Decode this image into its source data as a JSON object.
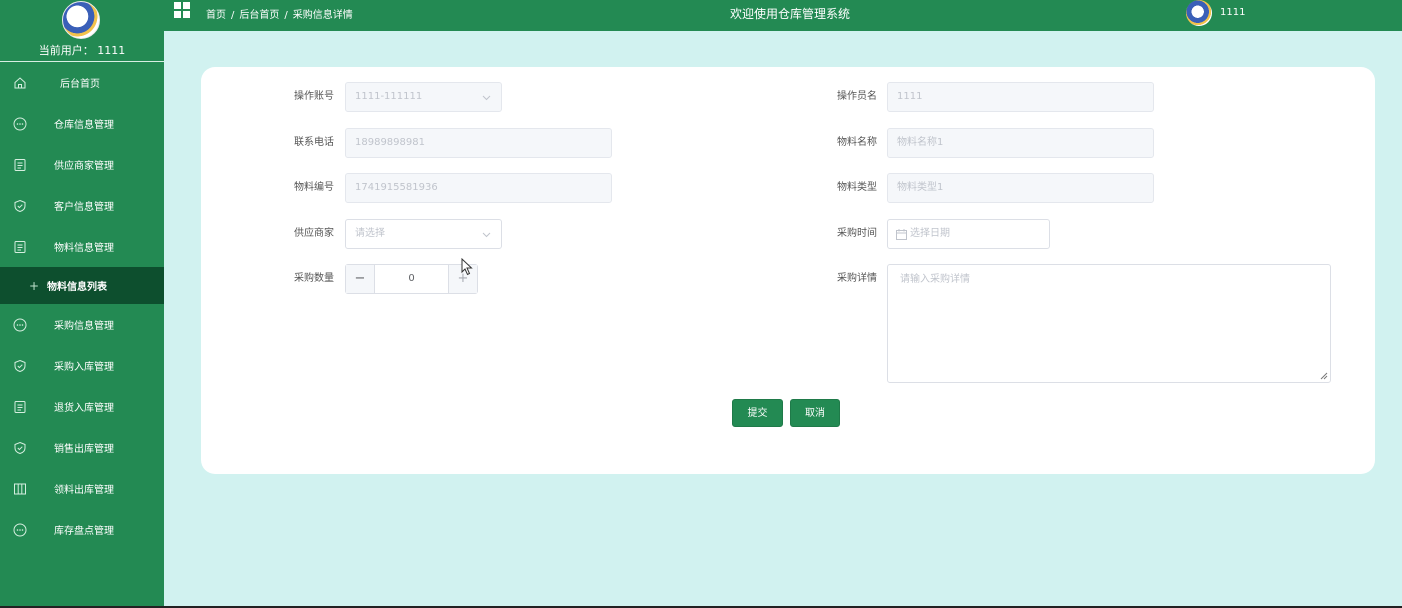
{
  "sidebar": {
    "current_user": "当前用户： 1111",
    "items": [
      {
        "label": "后台首页",
        "icon": "home-icon"
      },
      {
        "label": "仓库信息管理",
        "icon": "chat-icon"
      },
      {
        "label": "供应商家管理",
        "icon": "document-icon"
      },
      {
        "label": "客户信息管理",
        "icon": "shield-icon"
      },
      {
        "label": "物料信息管理",
        "icon": "document-icon"
      },
      {
        "label": "物料信息列表",
        "icon": "plus-icon"
      },
      {
        "label": "采购信息管理",
        "icon": "chat-icon"
      },
      {
        "label": "采购入库管理",
        "icon": "shield-icon"
      },
      {
        "label": "退货入库管理",
        "icon": "document-icon"
      },
      {
        "label": "销售出库管理",
        "icon": "shield-icon"
      },
      {
        "label": "领料出库管理",
        "icon": "columns-icon"
      },
      {
        "label": "库存盘点管理",
        "icon": "chat-icon"
      }
    ]
  },
  "header": {
    "breadcrumb": [
      "首页",
      "后台首页",
      "采购信息详情"
    ],
    "breadcrumb_sep": "/",
    "title": "欢迎使用仓库管理系统",
    "username": "1111"
  },
  "form": {
    "account": {
      "label": "操作账号",
      "value": "1111-111111"
    },
    "operator": {
      "label": "操作员名",
      "value": "1111"
    },
    "phone": {
      "label": "联系电话",
      "value": "18989898981"
    },
    "material_name": {
      "label": "物料名称",
      "value": "物料名称1"
    },
    "material_code": {
      "label": "物料编号",
      "value": "1741915581936"
    },
    "material_type": {
      "label": "物料类型",
      "value": "物料类型1"
    },
    "supplier": {
      "label": "供应商家",
      "placeholder": "请选择"
    },
    "purchase_time": {
      "label": "采购时间",
      "placeholder": "选择日期"
    },
    "quantity": {
      "label": "采购数量",
      "value": "0",
      "dec": "−",
      "inc": "+"
    },
    "details": {
      "label": "采购详情",
      "placeholder": "请输入采购详情"
    },
    "submit": "提交",
    "cancel": "取消"
  },
  "colors": {
    "primary": "#238a53",
    "active_bg": "#0d4f2e",
    "page_bg": "#d1f2f0"
  }
}
